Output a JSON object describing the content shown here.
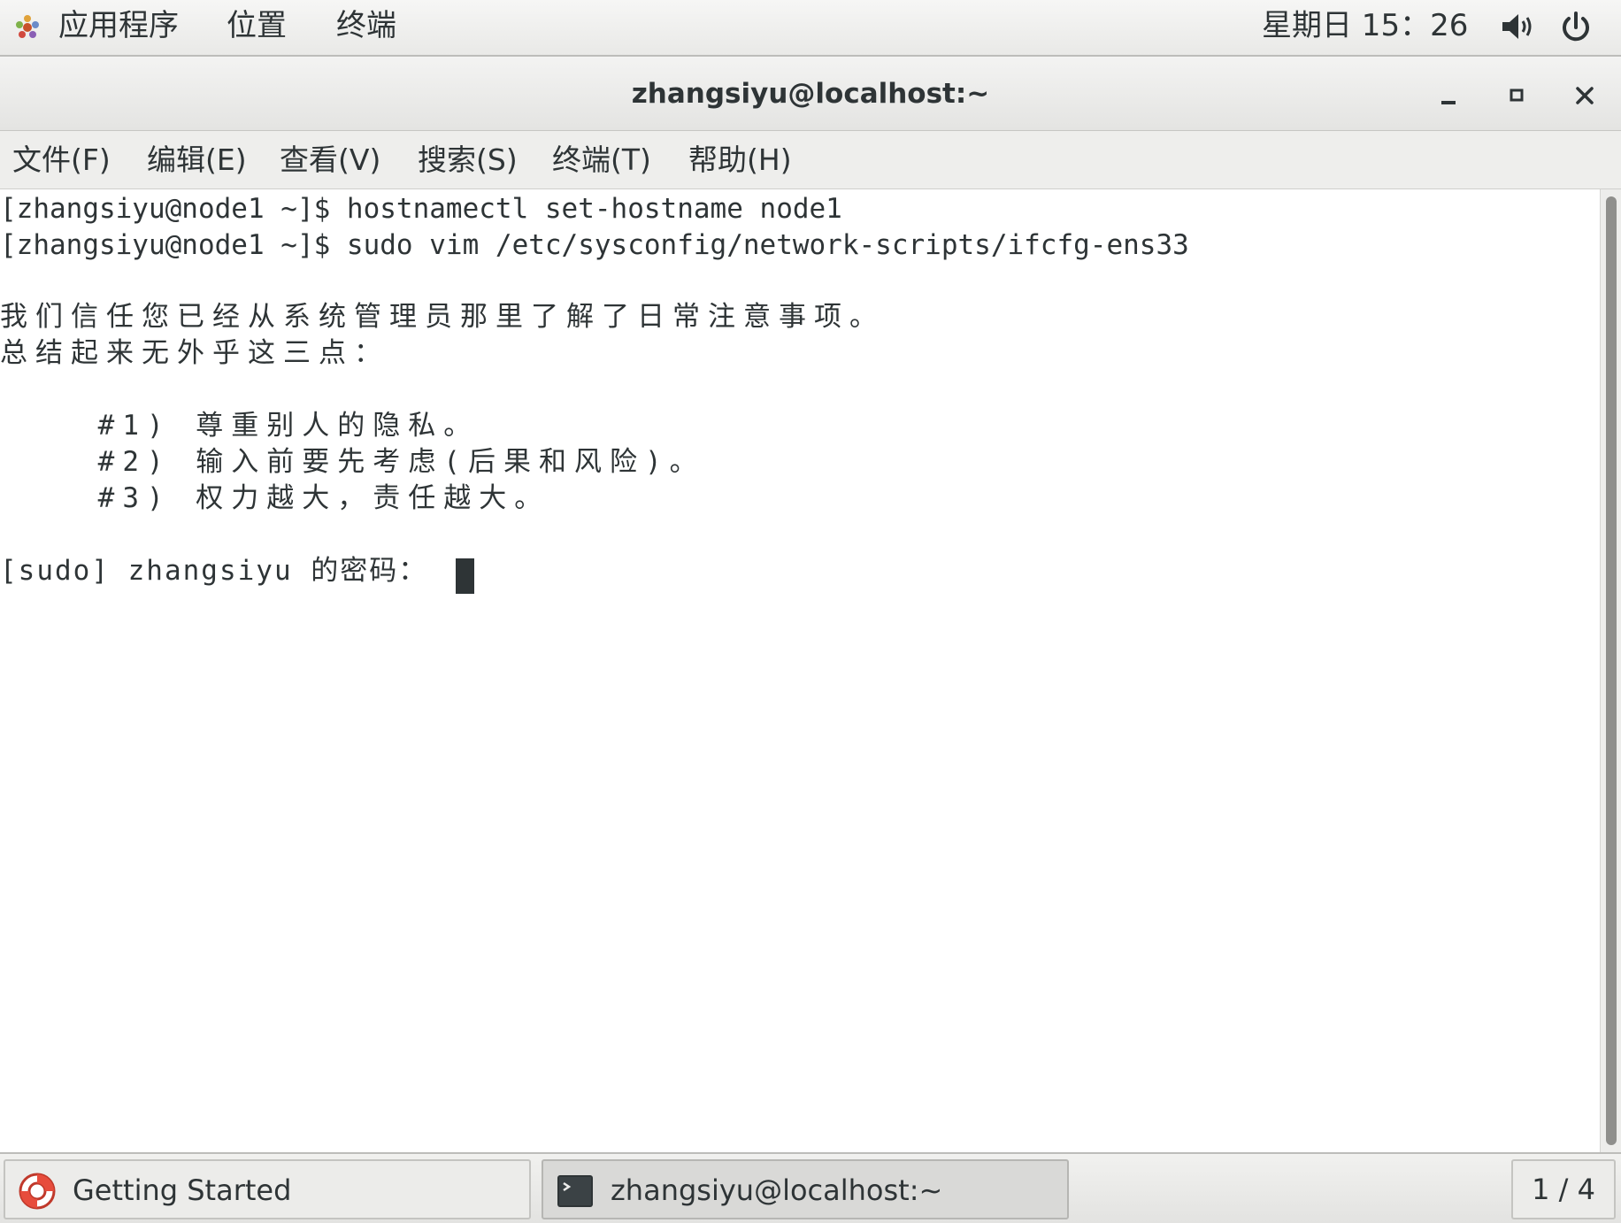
{
  "top_panel": {
    "menus": [
      "应用程序",
      "位置",
      "终端"
    ],
    "clock": "星期日 15：26",
    "icons": [
      "applications-icon",
      "volume-icon",
      "power-icon"
    ]
  },
  "window": {
    "title": "zhangsiyu@localhost:~",
    "controls": [
      "minimize",
      "maximize",
      "close"
    ]
  },
  "menubar": {
    "items": [
      "文件(F)",
      "编辑(E)",
      "查看(V)",
      "搜索(S)",
      "终端(T)",
      "帮助(H)"
    ]
  },
  "terminal": {
    "lines": [
      "[zhangsiyu@node1 ~]$ hostnamectl set-hostname node1",
      "[zhangsiyu@node1 ~]$ sudo vim /etc/sysconfig/network-scripts/ifcfg-ens33",
      "",
      "我们信任您已经从系统管理员那里了解了日常注意事项。",
      "总结起来无外乎这三点：",
      "",
      "    #1) 尊重别人的隐私。",
      "    #2) 输入前要先考虑(后果和风险)。",
      "    #3) 权力越大，责任越大。",
      "",
      "[sudo] zhangsiyu 的密码："
    ]
  },
  "taskbar": {
    "tasks": [
      "Getting Started",
      "zhangsiyu@localhost:~"
    ],
    "workspace": "1 / 4"
  },
  "colors": {
    "text": "#2e3436",
    "panel_bg": "#eeeeec",
    "terminal_bg": "#ffffff"
  }
}
